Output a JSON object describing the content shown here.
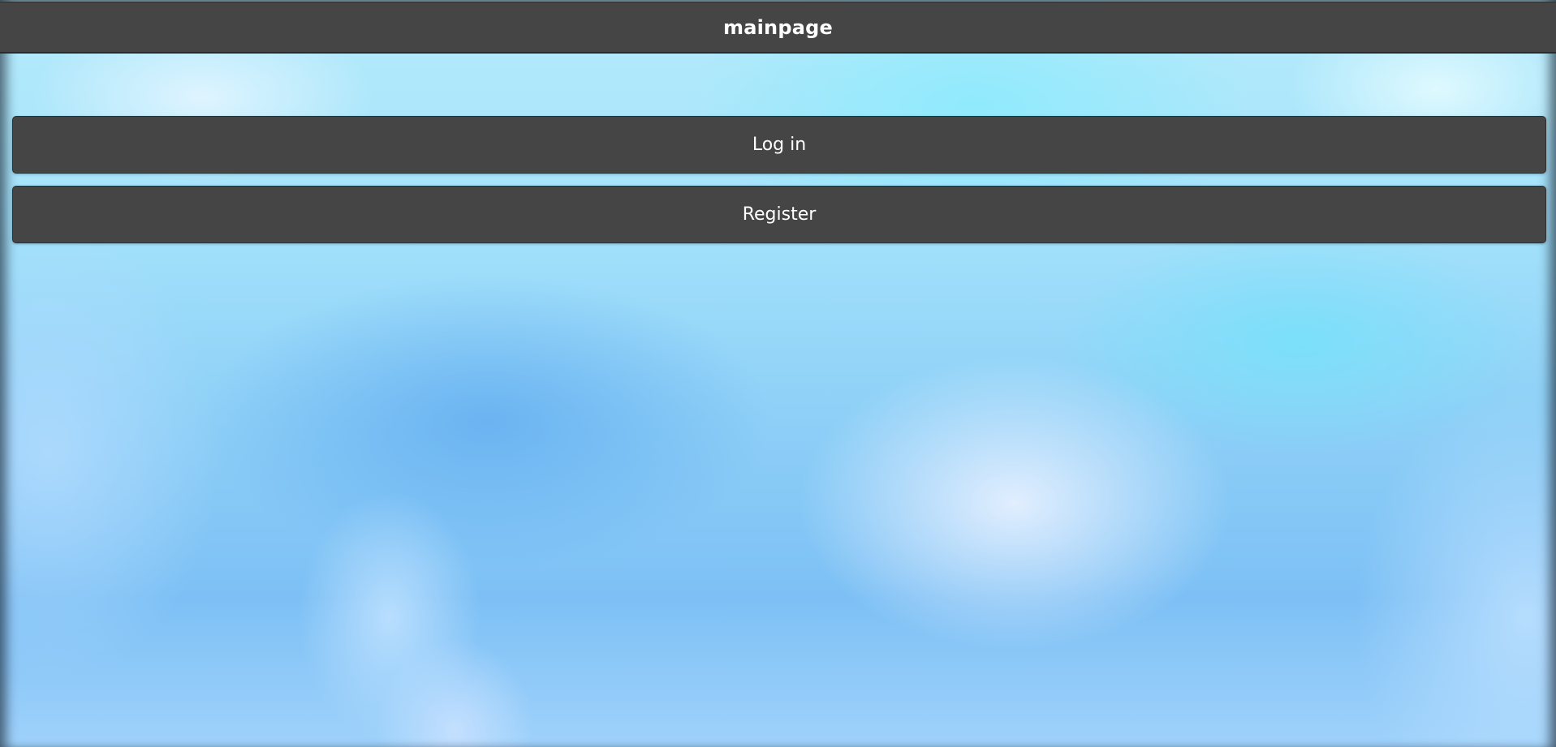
{
  "header": {
    "title": "mainpage"
  },
  "actions": {
    "login_label": "Log in",
    "register_label": "Register"
  },
  "colors": {
    "bar": "#454545",
    "text": "#ffffff",
    "background": "#7cc4f5"
  }
}
